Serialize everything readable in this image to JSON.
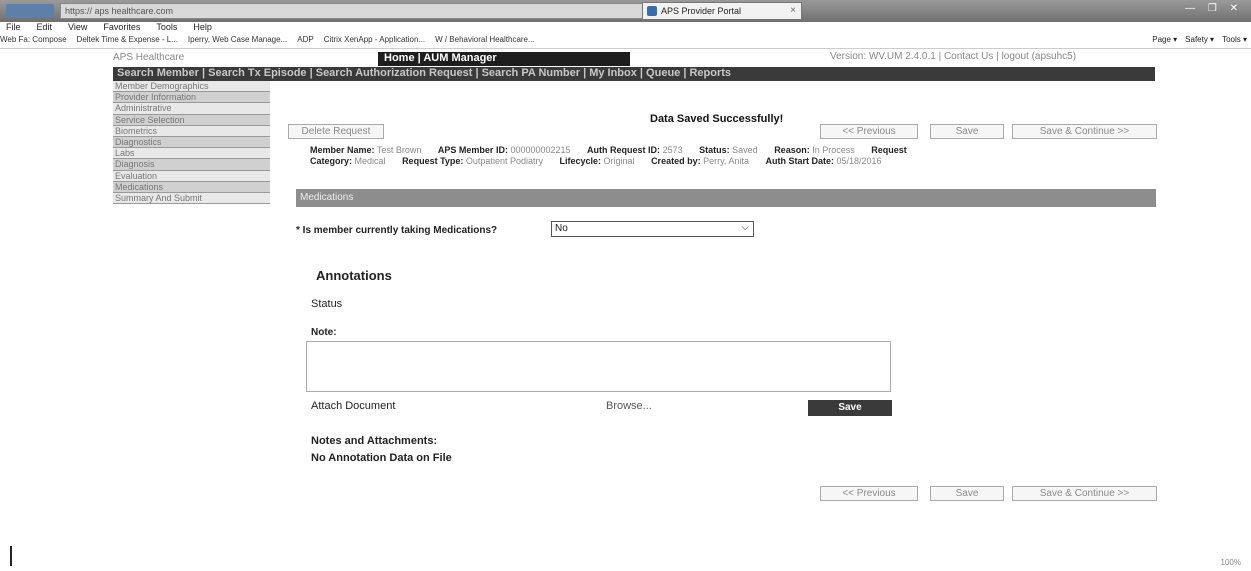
{
  "browser": {
    "address_text": "https://                aps healthcare.com",
    "tab_title": "APS Provider Portal",
    "tab_close": "×",
    "window_controls": "— ❐ ✕",
    "menu": [
      "File",
      "Edit",
      "View",
      "Favorites",
      "Tools",
      "Help"
    ],
    "favorites": [
      "Web Fa: Compose",
      "Deltek Time & Expense - L...",
      "Iperry, Web Case Manage...",
      "ADP",
      "Citrix XenApp - Application...",
      "W / Behavioral Healthcare..."
    ],
    "command_bar": [
      "Page ▾",
      "Safety ▾",
      "Tools ▾"
    ]
  },
  "header": {
    "brand": "APS Healthcare",
    "home_bar": "Home | AUM Manager",
    "version_line": "Version: WV.UM 2.4.0.1 | Contact Us | logout (apsuhc5)"
  },
  "main_nav": "Search Member | Search Tx Episode | Search Authorization Request | Search PA Number | My Inbox | Queue | Reports",
  "left_nav": [
    "Member Demographics",
    "Provider Information",
    "Administrative",
    "Service Selection",
    "Biometrics",
    "Diagnostics",
    "Labs",
    "Diagnosis",
    "Evaluation",
    "Medications",
    "Summary And Submit"
  ],
  "saved_message": "Data Saved Successfully!",
  "buttons": {
    "delete": "Delete Request",
    "previous": "<< Previous",
    "save": "Save",
    "save_continue": "Save & Continue >>"
  },
  "member_info": {
    "member_name_label": "Member Name:",
    "member_name": "Test Brown",
    "member_id_label": "APS Member ID:",
    "member_id": "000000002215",
    "auth_request_label": "Auth Request ID:",
    "auth_request_id": "2573",
    "status_label": "Status:",
    "status": "Saved",
    "reason_label": "Reason:",
    "reason": "In Process",
    "request_label": "Request",
    "category_label": "Category:",
    "category": "Medical",
    "request_type_label": "Request Type:",
    "request_type": "Outpatient Podiatry",
    "lifecycle_label": "Lifecycle:",
    "lifecycle": "Original",
    "created_by_label": "Created by:",
    "created_by": "Perry, Anita",
    "auth_start_label": "Auth Start Date:",
    "auth_start": "05/18/2016"
  },
  "section_title": "Medications",
  "medications_question": "* Is member currently taking Medications?",
  "medications_answer": "No",
  "annotations": {
    "title": "Annotations",
    "status_label": "Status",
    "note_label": "Note:",
    "note_value": "",
    "attach_label": "Attach Document",
    "browse_label": "Browse...",
    "save_label": "Save",
    "notes_attachments_label": "Notes and Attachments:",
    "no_data": "No Annotation Data on File"
  },
  "zoom": "100%"
}
